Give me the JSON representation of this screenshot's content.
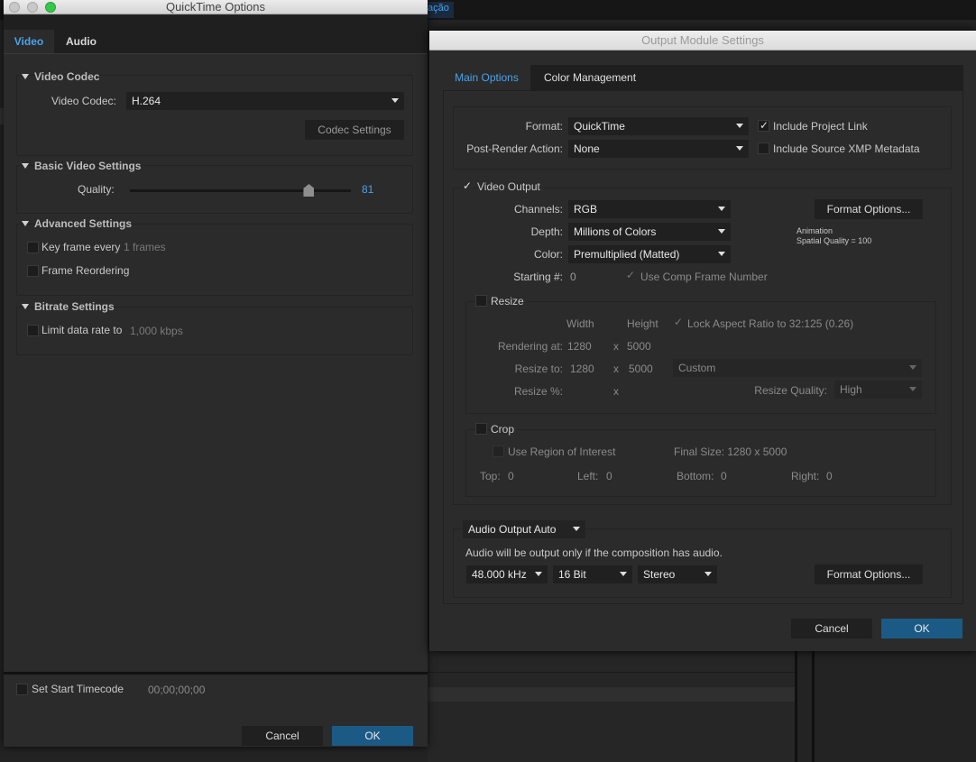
{
  "background": {
    "tab_label": "tação"
  },
  "quicktime": {
    "title": "QuickTime Options",
    "tabs": [
      {
        "label": "Video"
      },
      {
        "label": "Audio"
      }
    ],
    "video_codec_section": {
      "heading": "Video Codec",
      "label": "Video Codec:",
      "value": "H.264",
      "codec_settings": "Codec Settings"
    },
    "basic_section": {
      "heading": "Basic Video Settings",
      "quality_label": "Quality:",
      "quality_value": "81",
      "quality_fraction": 0.81
    },
    "advanced_section": {
      "heading": "Advanced Settings",
      "keyframe_label": "Key frame every",
      "keyframe_value": "1 frames",
      "reorder_label": "Frame Reordering"
    },
    "bitrate_section": {
      "heading": "Bitrate Settings",
      "limit_label": "Limit data rate to",
      "limit_value": "1,000 kbps"
    },
    "timecode": {
      "label": "Set Start Timecode",
      "value": "00;00;00;00"
    },
    "cancel": "Cancel",
    "ok": "OK"
  },
  "output_module": {
    "title": "Output Module Settings",
    "tabs": [
      {
        "label": "Main Options"
      },
      {
        "label": "Color Management"
      }
    ],
    "format_label": "Format:",
    "format_value": "QuickTime",
    "post_render_label": "Post-Render Action:",
    "post_render_value": "None",
    "include_project_link": "Include Project Link",
    "include_xmp": "Include Source XMP Metadata",
    "video_output": "Video Output",
    "channels_label": "Channels:",
    "channels_value": "RGB",
    "depth_label": "Depth:",
    "depth_value": "Millions of Colors",
    "color_label": "Color:",
    "color_value": "Premultiplied (Matted)",
    "starting_label": "Starting #:",
    "starting_value": "0",
    "use_comp_frame": "Use Comp Frame Number",
    "format_options": "Format Options...",
    "codec_info_1": "Animation",
    "codec_info_2": "Spatial Quality = 100",
    "resize": {
      "label": "Resize",
      "width": "Width",
      "height": "Height",
      "lock_aspect": "Lock Aspect Ratio to 32:125 (0.26)",
      "rendering_at": "Rendering at:",
      "ra_w": "1280",
      "ra_h": "5000",
      "resize_to": "Resize to:",
      "rt_w": "1280",
      "rt_h": "5000",
      "preset": "Custom",
      "resize_pct": "Resize %:",
      "x": "x",
      "quality_label": "Resize Quality:",
      "quality_value": "High"
    },
    "crop": {
      "label": "Crop",
      "use_roi": "Use Region of Interest",
      "final_size": "Final Size: 1280 x 5000",
      "top": "Top:",
      "top_v": "0",
      "left": "Left:",
      "left_v": "0",
      "bottom": "Bottom:",
      "bottom_v": "0",
      "right": "Right:",
      "right_v": "0"
    },
    "audio": {
      "mode": "Audio Output Auto",
      "note": "Audio will be output only if the composition has audio.",
      "rate": "48.000 kHz",
      "bits": "16 Bit",
      "channels": "Stereo",
      "format_options": "Format Options..."
    },
    "cancel": "Cancel",
    "ok": "OK"
  }
}
